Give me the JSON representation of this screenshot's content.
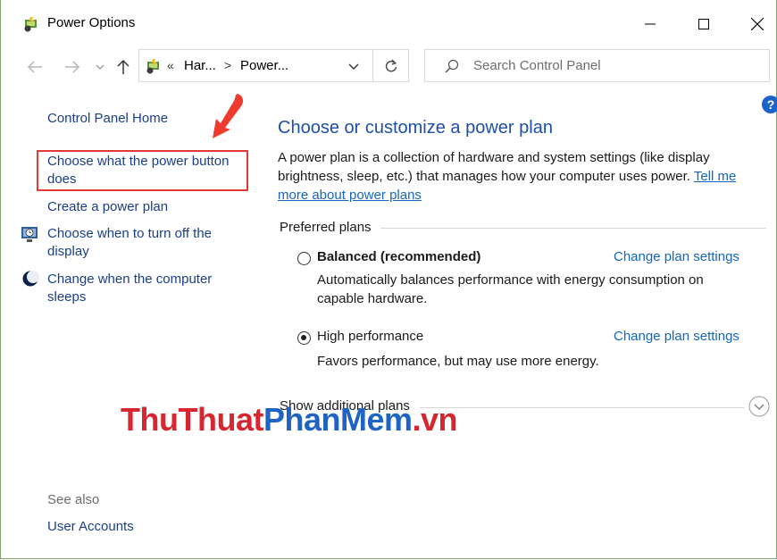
{
  "window": {
    "title": "Power Options"
  },
  "address_bar": {
    "chevrons": "«",
    "crumbs": [
      "Har...",
      "Power..."
    ],
    "separator": ">"
  },
  "search": {
    "placeholder": "Search Control Panel"
  },
  "help": {
    "label": "?"
  },
  "sidebar": {
    "home": "Control Panel Home",
    "items": [
      {
        "label": "Choose what the power button does",
        "icon": null
      },
      {
        "label": "Create a power plan",
        "icon": null
      },
      {
        "label": "Choose when to turn off the display",
        "icon": "display-clock-icon"
      },
      {
        "label": "Change when the computer sleeps",
        "icon": "moon-icon"
      }
    ],
    "see_also": "See also",
    "user_accounts": "User Accounts"
  },
  "main": {
    "title": "Choose or customize a power plan",
    "description": "A power plan is a collection of hardware and system settings (like display brightness, sleep, etc.) that manages how your computer uses power.",
    "description_link": "Tell me more about power plans",
    "preferred_plans_label": "Preferred plans",
    "plans": [
      {
        "name": "Balanced (recommended)",
        "selected": false,
        "description": "Automatically balances performance with energy consumption on capable hardware.",
        "change_label": "Change plan settings"
      },
      {
        "name": "High performance",
        "selected": true,
        "description": "Favors performance, but may use more energy.",
        "change_label": "Change plan settings"
      }
    ],
    "show_more": "Show additional plans"
  },
  "watermark": {
    "part1": "ThuThuat",
    "part2": "PhanMem",
    "part3": ".vn"
  },
  "colors": {
    "link": "#1a3e8a",
    "accent": "#1565c0",
    "highlight_box": "#e53935",
    "watermark_red": "#d7262f",
    "watermark_blue": "#1f63c4"
  }
}
